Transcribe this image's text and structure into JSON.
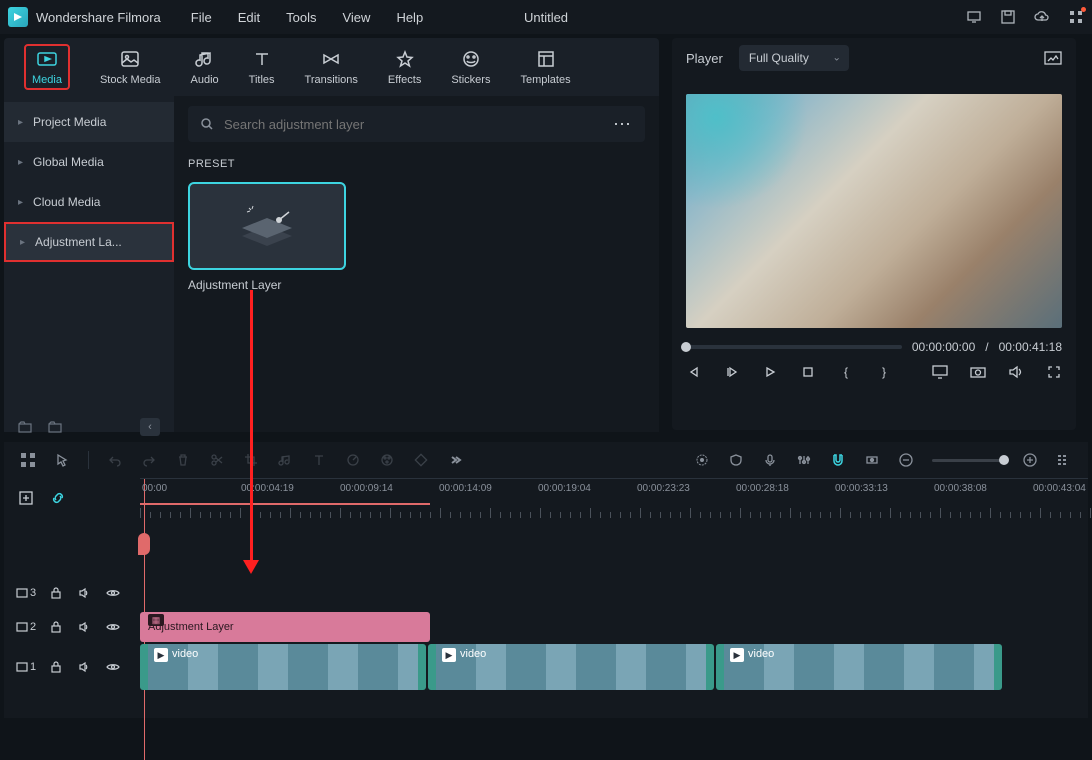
{
  "app": {
    "title": "Wondershare Filmora",
    "doc": "Untitled"
  },
  "menu": [
    "File",
    "Edit",
    "Tools",
    "View",
    "Help"
  ],
  "toolTabs": [
    {
      "label": "Media",
      "icon": "media-icon",
      "active": true
    },
    {
      "label": "Stock Media",
      "icon": "stock-icon"
    },
    {
      "label": "Audio",
      "icon": "audio-icon"
    },
    {
      "label": "Titles",
      "icon": "titles-icon"
    },
    {
      "label": "Transitions",
      "icon": "transitions-icon"
    },
    {
      "label": "Effects",
      "icon": "effects-icon"
    },
    {
      "label": "Stickers",
      "icon": "stickers-icon"
    },
    {
      "label": "Templates",
      "icon": "templates-icon"
    }
  ],
  "sidebar": {
    "items": [
      {
        "label": "Project Media"
      },
      {
        "label": "Global Media"
      },
      {
        "label": "Cloud Media"
      },
      {
        "label": "Adjustment La...",
        "selected": true
      }
    ]
  },
  "search": {
    "placeholder": "Search adjustment layer"
  },
  "presetHeading": "PRESET",
  "preset": {
    "name": "Adjustment Layer"
  },
  "player": {
    "label": "Player",
    "quality": "Full Quality",
    "current": "00:00:00:00",
    "total": "00:00:41:18",
    "sep": "/"
  },
  "ruler": {
    "labels": [
      "00:00",
      "00:00:04:19",
      "00:00:09:14",
      "00:00:14:09",
      "00:00:19:04",
      "00:00:23:23",
      "00:00:28:18",
      "00:00:33:13",
      "00:00:38:08",
      "00:00:43:04"
    ]
  },
  "tracks": {
    "t3": "3",
    "t2": "2",
    "t1": "1",
    "adjClip": "Adjustment Layer",
    "videoLabel": "video"
  }
}
